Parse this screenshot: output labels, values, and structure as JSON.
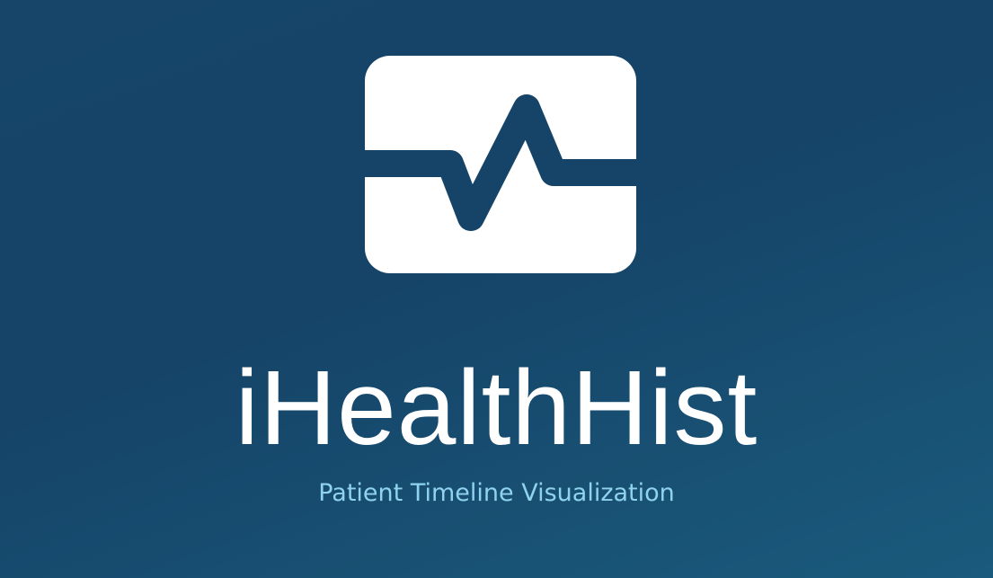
{
  "splash": {
    "icon": "heartbeat-monitor-icon",
    "title": "iHealthHist",
    "subtitle": "Patient Timeline Visualization"
  },
  "colors": {
    "background_top": "#17456a",
    "background_bottom": "#1a5a7c",
    "title": "#ffffff",
    "subtitle": "#8fd3ec"
  }
}
